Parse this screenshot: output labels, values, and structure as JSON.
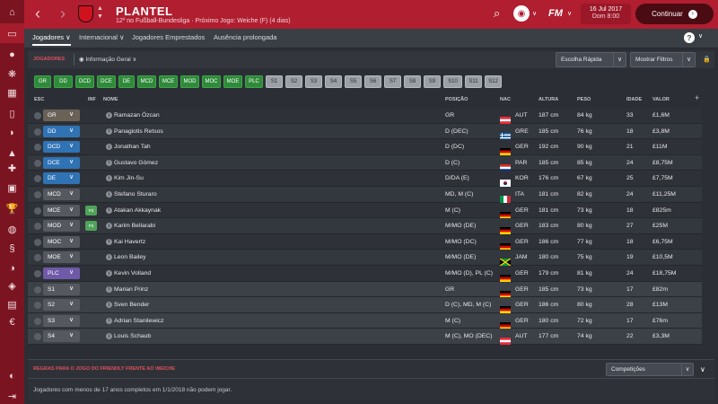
{
  "sidebar": {
    "icons": [
      "home-icon",
      "inbox-icon",
      "squad-icon",
      "tactics-icon",
      "dynamics-icon",
      "schedule-icon",
      "data-hub-icon",
      "staff-icon",
      "training-icon",
      "transfers-icon",
      "scouting-icon",
      "competitions-icon",
      "club-vision-icon",
      "development-icon",
      "shield-icon",
      "finances-icon",
      "euro-icon",
      "help-icon",
      "exit-icon"
    ]
  },
  "header": {
    "title": "PLANTEL",
    "subtitle": "12º no Fußball-Bundesliga · Próximo Jogo: Weiche (F) (4 dias)",
    "date_line1": "16 Jul 2017",
    "date_line2": "Dom 8:00",
    "continue_label": "Continuar",
    "fm_logo": "FM"
  },
  "tabs": [
    {
      "label": "Jogadores ∨",
      "active": true
    },
    {
      "label": "Internacional ∨",
      "active": false
    },
    {
      "label": "Jogadores Emprestados",
      "active": false
    },
    {
      "label": "Ausência prolongada",
      "active": false
    }
  ],
  "toolbar": {
    "section_label": "JOGADORES",
    "view_label": "Informação Geral",
    "quick_pick_label": "Escolha Rápida",
    "filters_label": "Mostrar Filtros"
  },
  "position_chips": [
    {
      "label": "GR",
      "style": "green"
    },
    {
      "label": "DD",
      "style": "green"
    },
    {
      "label": "DCD",
      "style": "green"
    },
    {
      "label": "DCE",
      "style": "green"
    },
    {
      "label": "DE",
      "style": "green"
    },
    {
      "label": "MCD",
      "style": "green"
    },
    {
      "label": "MCE",
      "style": "green"
    },
    {
      "label": "MOD",
      "style": "green"
    },
    {
      "label": "MOC",
      "style": "green"
    },
    {
      "label": "MOE",
      "style": "green"
    },
    {
      "label": "PLC",
      "style": "green"
    },
    {
      "label": "S1",
      "style": "grey"
    },
    {
      "label": "S2",
      "style": "grey"
    },
    {
      "label": "S3",
      "style": "grey"
    },
    {
      "label": "S4",
      "style": "grey"
    },
    {
      "label": "S5",
      "style": "grey"
    },
    {
      "label": "S6",
      "style": "grey"
    },
    {
      "label": "S7",
      "style": "grey"
    },
    {
      "label": "S8",
      "style": "grey"
    },
    {
      "label": "S9",
      "style": "grey"
    },
    {
      "label": "S10",
      "style": "grey"
    },
    {
      "label": "S11",
      "style": "grey"
    },
    {
      "label": "S12",
      "style": "grey"
    }
  ],
  "columns": {
    "esc": "ESC",
    "inf": "INF",
    "nome": "NOME",
    "posicao": "POSIÇÃO",
    "nac": "NAC",
    "altura": "ALTURA",
    "peso": "PESO",
    "idade": "IDADE",
    "valor": "VALOR",
    "add": "+"
  },
  "players": [
    {
      "esc": "GR",
      "esc_color": "#6b6257",
      "pd": false,
      "name": "Ramazan Özcan",
      "position": "GR",
      "nat": "AUT",
      "flag": "aut",
      "height": "187 cm",
      "weight": "84 kg",
      "age": "33",
      "value": "£1,6M"
    },
    {
      "esc": "DD",
      "esc_color": "#2f73b5",
      "pd": false,
      "name": "Panagiotis Retsos",
      "position": "D (DEC)",
      "nat": "GRE",
      "flag": "gre",
      "height": "185 cm",
      "weight": "76 kg",
      "age": "18",
      "value": "£3,8M"
    },
    {
      "esc": "DCD",
      "esc_color": "#2f73b5",
      "pd": false,
      "name": "Jonathan Tah",
      "position": "D (DC)",
      "nat": "GER",
      "flag": "ger",
      "height": "192 cm",
      "weight": "90 kg",
      "age": "21",
      "value": "£11M"
    },
    {
      "esc": "DCE",
      "esc_color": "#2f73b5",
      "pd": false,
      "name": "Gustavo Gómez",
      "position": "D (C)",
      "nat": "PAR",
      "flag": "par",
      "height": "185 cm",
      "weight": "85 kg",
      "age": "24",
      "value": "£8,75M"
    },
    {
      "esc": "DE",
      "esc_color": "#2f73b5",
      "pd": false,
      "name": "Kim Jin-Su",
      "position": "D/DA (E)",
      "nat": "KOR",
      "flag": "kor",
      "height": "176 cm",
      "weight": "67 kg",
      "age": "25",
      "value": "£7,75M"
    },
    {
      "esc": "MCD",
      "esc_color": "#55595f",
      "pd": false,
      "name": "Stefano Sturaro",
      "position": "MD, M (C)",
      "nat": "ITA",
      "flag": "ita",
      "height": "181 cm",
      "weight": "82 kg",
      "age": "24",
      "value": "£11,25M"
    },
    {
      "esc": "MCE",
      "esc_color": "#55595f",
      "pd": true,
      "name": "Atakan Akkaynak",
      "position": "M (C)",
      "nat": "GER",
      "flag": "ger",
      "height": "181 cm",
      "weight": "73 kg",
      "age": "18",
      "value": "£825m"
    },
    {
      "esc": "MOD",
      "esc_color": "#55595f",
      "pd": true,
      "name": "Karim Bellarabi",
      "position": "M/MO (DE)",
      "nat": "GER",
      "flag": "ger",
      "height": "183 cm",
      "weight": "80 kg",
      "age": "27",
      "value": "£25M"
    },
    {
      "esc": "MOC",
      "esc_color": "#55595f",
      "pd": false,
      "name": "Kai Havertz",
      "position": "M/MO (DC)",
      "nat": "GER",
      "flag": "ger",
      "height": "186 cm",
      "weight": "77 kg",
      "age": "18",
      "value": "£6,75M"
    },
    {
      "esc": "MOE",
      "esc_color": "#55595f",
      "pd": false,
      "name": "Leon Bailey",
      "position": "M/MO (DE)",
      "nat": "JAM",
      "flag": "jam",
      "height": "180 cm",
      "weight": "75 kg",
      "age": "19",
      "value": "£10,5M"
    },
    {
      "esc": "PLC",
      "esc_color": "#6e5aa8",
      "pd": false,
      "name": "Kevin Volland",
      "position": "M/MO (D), PL (C)",
      "nat": "GER",
      "flag": "ger",
      "height": "179 cm",
      "weight": "81 kg",
      "age": "24",
      "value": "£18,75M"
    },
    {
      "esc": "S1",
      "esc_color": "#55595f",
      "pd": false,
      "name": "Marian Prinz",
      "position": "GR",
      "nat": "GER",
      "flag": "ger",
      "height": "185 cm",
      "weight": "73 kg",
      "age": "17",
      "value": "£82m"
    },
    {
      "esc": "S2",
      "esc_color": "#55595f",
      "pd": false,
      "name": "Sven Bender",
      "position": "D (C), MD, M (C)",
      "nat": "GER",
      "flag": "ger",
      "height": "186 cm",
      "weight": "80 kg",
      "age": "28",
      "value": "£13M"
    },
    {
      "esc": "S3",
      "esc_color": "#55595f",
      "pd": false,
      "name": "Adrian Stanilewicz",
      "position": "M (C)",
      "nat": "GER",
      "flag": "ger",
      "height": "180 cm",
      "weight": "72 kg",
      "age": "17",
      "value": "£76m"
    },
    {
      "esc": "S4",
      "esc_color": "#55595f",
      "pd": false,
      "name": "Louis Schaub",
      "position": "M (C), MO (DEC)",
      "nat": "AUT",
      "flag": "aut",
      "height": "177 cm",
      "weight": "74 kg",
      "age": "22",
      "value": "£3,3M"
    }
  ],
  "pd_label": "Pd",
  "bottom": {
    "header": "REGRAS PARA O JOGO DO FRIENDLY FRENTE AO WEICHE",
    "competitions_label": "Competições",
    "rule_text": "Jogadores com menos de 17 anos completos em 1/1/2018 não podem jogar."
  }
}
